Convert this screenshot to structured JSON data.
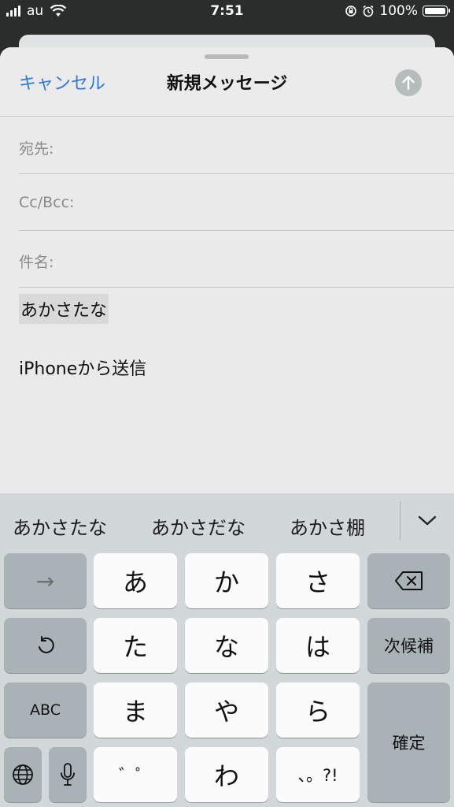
{
  "status_bar": {
    "carrier": "au",
    "time": "7:51",
    "battery": "100%",
    "icons": [
      "signal-icon",
      "wifi-icon",
      "orientation-lock-icon",
      "alarm-icon",
      "battery-icon"
    ]
  },
  "compose": {
    "cancel_label": "キャンセル",
    "title": "新規メッセージ",
    "send_icon": "arrow-up-icon",
    "to_label": "宛先:",
    "cc_label": "Cc/Bcc:",
    "subject_label": "件名:",
    "body_text": "あかさたな",
    "signature": "iPhoneから送信"
  },
  "keyboard": {
    "candidates": [
      "あかさたな",
      "あかさだな",
      "あかさ棚"
    ],
    "expand_icon": "chevron-down-icon",
    "keys": {
      "arrow": "→",
      "a": "あ",
      "ka": "か",
      "sa": "さ",
      "undo_icon": "undo-icon",
      "ta": "た",
      "na": "な",
      "ha": "は",
      "next_candidate": "次候補",
      "abc": "ABC",
      "ma": "ま",
      "ya": "や",
      "ra": "ら",
      "confirm": "確定",
      "dakuten": "゛゜",
      "wa": "わ",
      "punct": "、。?!",
      "globe_icon": "globe-icon",
      "mic_icon": "microphone-icon",
      "delete_icon": "delete-icon"
    }
  },
  "colors": {
    "accent": "#2f7ad8",
    "keyboard_bg": "#d2d7d9",
    "key_light": "#fbfbfb",
    "key_dark": "#a9b2b6"
  }
}
